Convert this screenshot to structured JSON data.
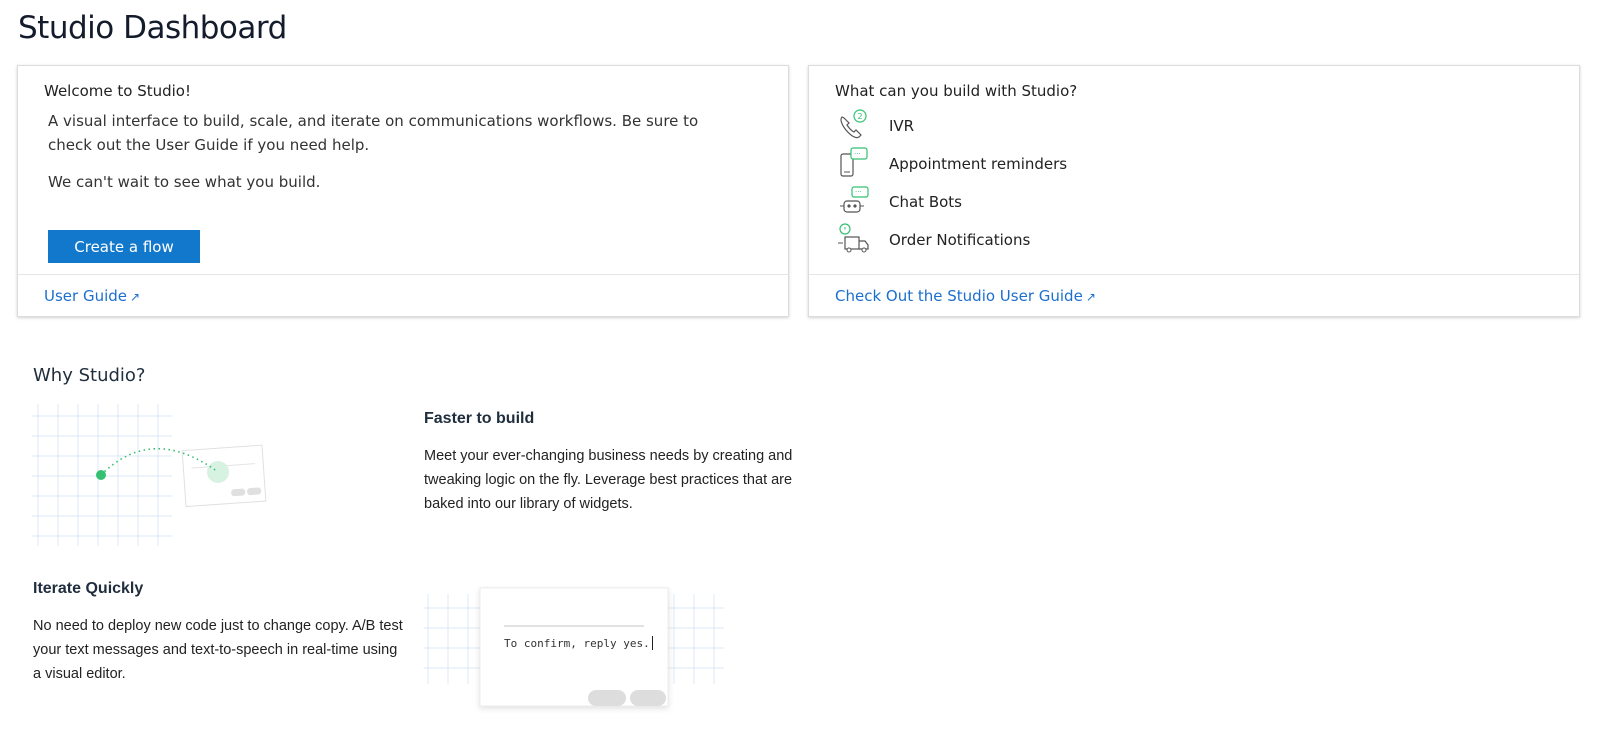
{
  "page": {
    "title": "Studio Dashboard"
  },
  "welcome_card": {
    "title": "Welcome to Studio!",
    "paragraph1": "A visual interface to build, scale, and iterate on communications workflows. Be sure to check out the User Guide if you need help.",
    "paragraph2": "We can't wait to see what you build.",
    "create_button": "Create a flow",
    "footer_link": "User Guide",
    "footer_link_icon": "external-link-icon"
  },
  "build_card": {
    "title": "What can you build with Studio?",
    "items": [
      {
        "label": "IVR",
        "icon": "phone-ivr-icon"
      },
      {
        "label": "Appointment reminders",
        "icon": "mobile-message-icon"
      },
      {
        "label": "Chat Bots",
        "icon": "chat-bot-icon"
      },
      {
        "label": "Order Notifications",
        "icon": "delivery-truck-icon"
      }
    ],
    "footer_link": "Check Out the Studio User Guide",
    "footer_link_icon": "external-link-icon"
  },
  "why_studio": {
    "title": "Why Studio?",
    "features": [
      {
        "heading": "Faster to build",
        "text": "Meet your ever-changing business needs by creating and tweaking logic on the fly. Leverage best practices that are baked into our library of widgets."
      },
      {
        "heading": "Iterate Quickly",
        "text": "No need to deploy new code just to change copy. A/B test your text messages and text-to-speech in real-time using a visual editor."
      }
    ],
    "editor_sample_text": "To confirm, reply yes."
  },
  "colors": {
    "primary": "#1178cc",
    "link": "#1c6fcf",
    "accent_green": "#34c070",
    "grid": "#dbe9f7"
  }
}
